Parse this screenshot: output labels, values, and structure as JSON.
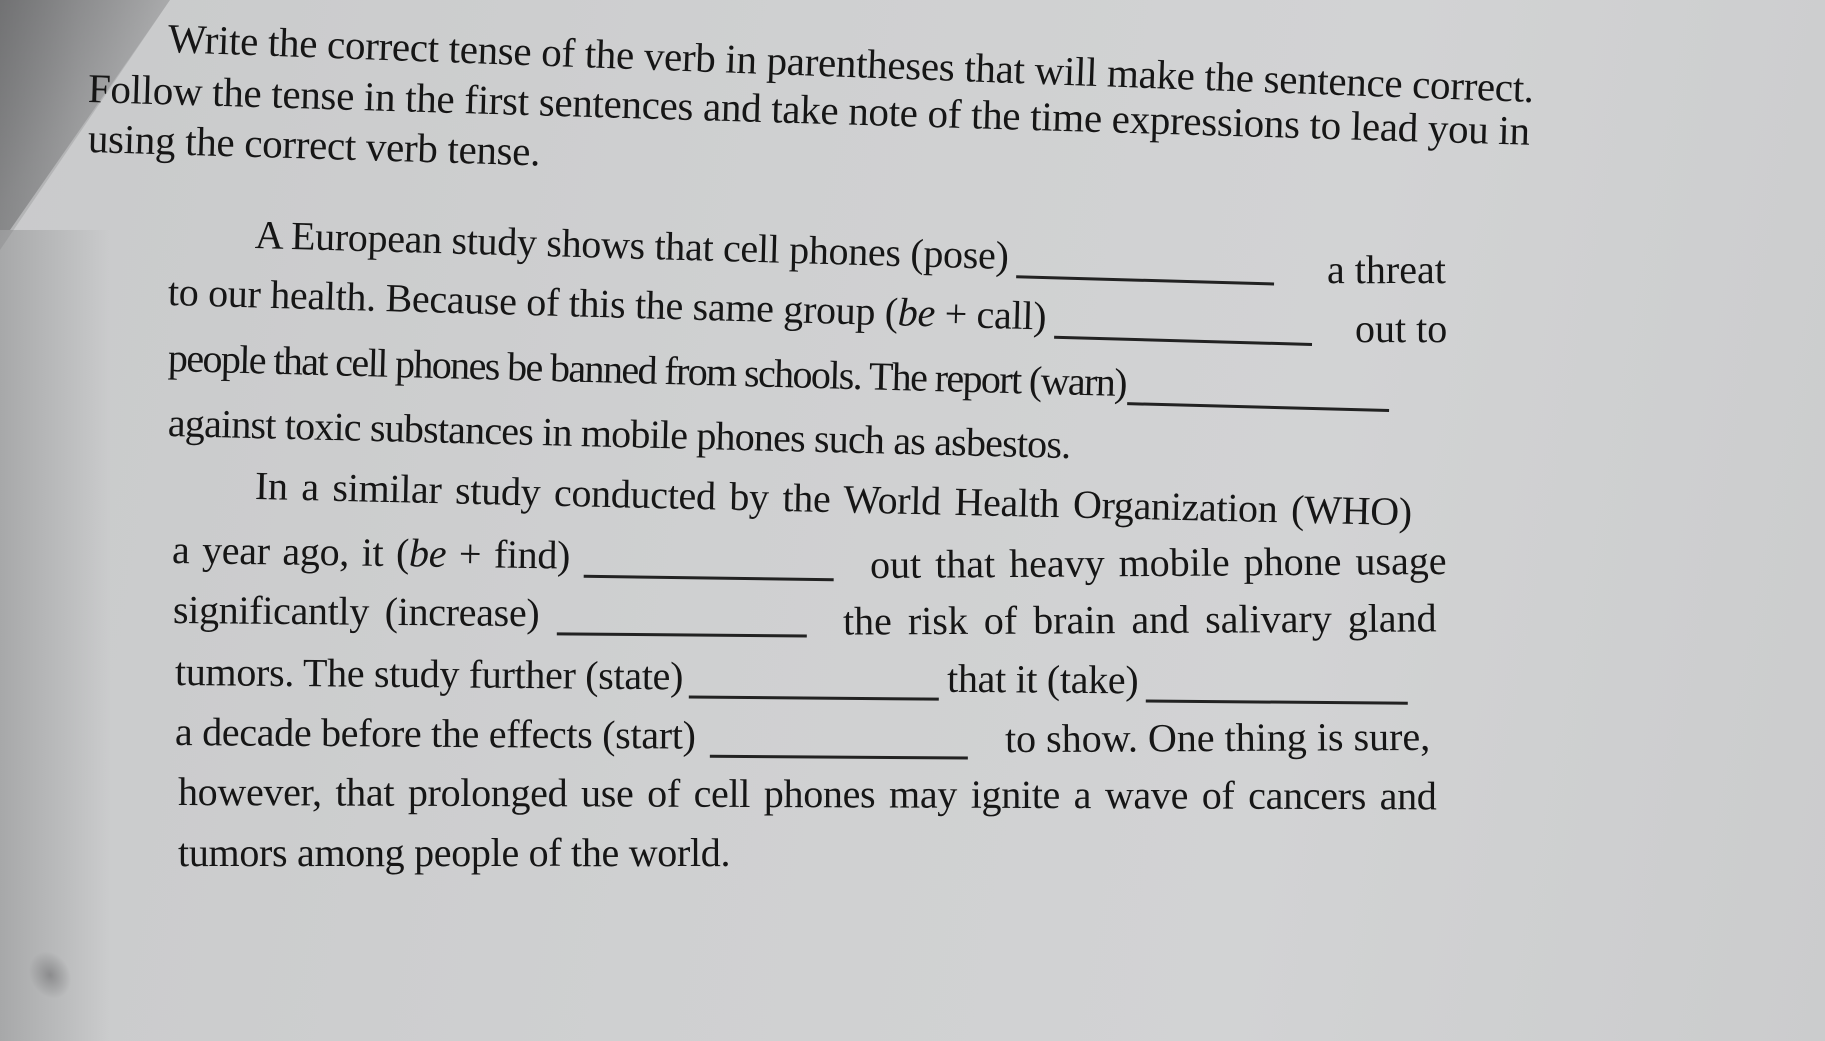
{
  "instructions": {
    "line1": "Write the correct tense of the verb in parentheses that will make the sentence correct.",
    "line2": "Follow the tense in the first sentences and take note of the time expressions to lead you in",
    "line3": "using the correct verb tense."
  },
  "paragraph1": {
    "l1_before": "A European study shows that cell phones (pose)",
    "l1_after": "a threat",
    "l2_before": "to our health. Because of this the same group (",
    "l2_italic": "be",
    "l2_mid": " + call)",
    "l2_after": "out to",
    "l3_before": "people that cell phones be banned from schools. The report (warn)",
    "l4": "against toxic substances in mobile phones such as asbestos."
  },
  "paragraph2": {
    "l1": "In a similar study conducted by the World Health Organization (WHO)",
    "l2_before": "a year ago, it (",
    "l2_italic": "be",
    "l2_mid": " + find)",
    "l2_after": "out that heavy mobile phone usage",
    "l3_before": "significantly (increase)",
    "l3_after": "the risk of brain and salivary gland",
    "l4_before": "tumors. The study further (state)",
    "l4_mid": "that it (take)",
    "l5_before": "a decade before the effects (start)",
    "l5_after": "to show. One thing is sure,",
    "l6": "however, that prolonged use of cell phones may ignite a wave of cancers and",
    "l7": "tumors among people of the world."
  },
  "blanks": {
    "pose": "",
    "be_call": "",
    "warn": "",
    "be_find": "",
    "increase": "",
    "state": "",
    "take": "",
    "start": ""
  }
}
